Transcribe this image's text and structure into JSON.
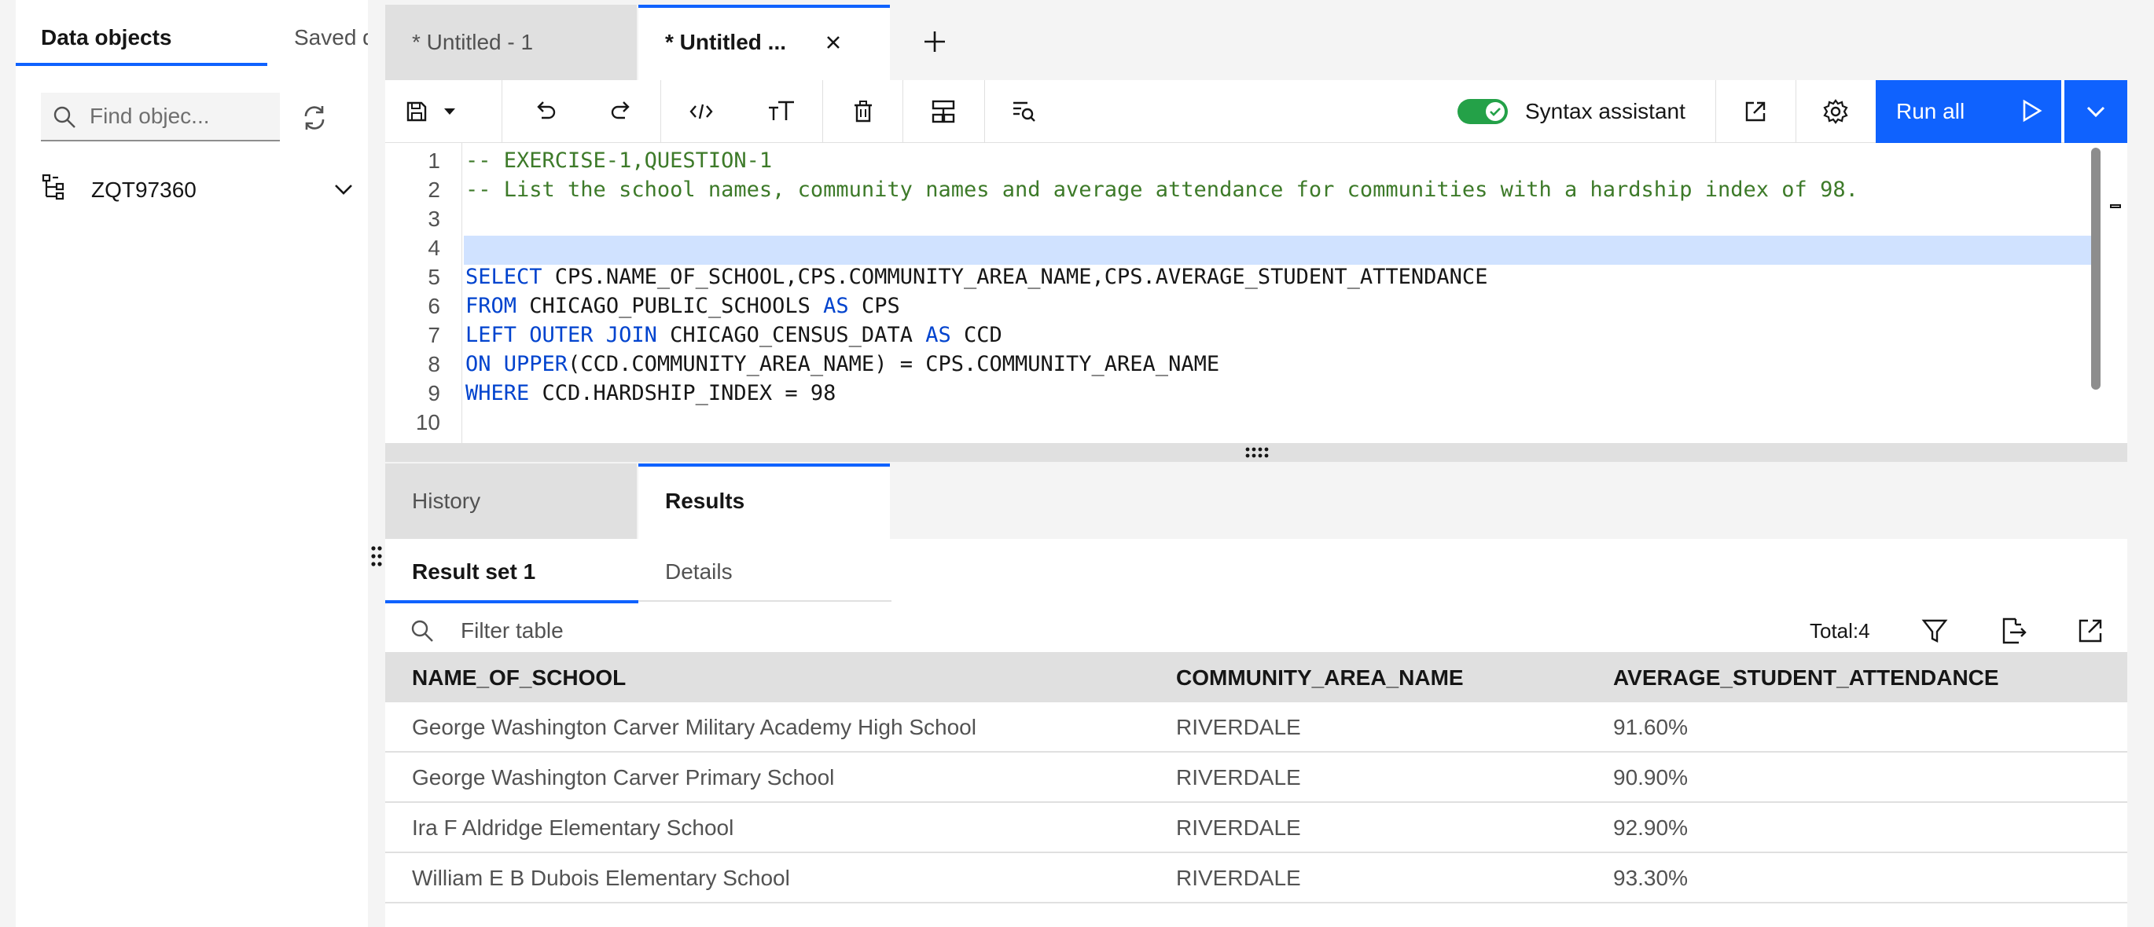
{
  "left_panel": {
    "tabs": [
      "Data objects",
      "Saved q"
    ],
    "search_placeholder": "Find objec...",
    "schema": "ZQT97360"
  },
  "editor_tabs": [
    "* Untitled - 1",
    "* Untitled ..."
  ],
  "toolbar": {
    "syntax_assistant_label": "Syntax assistant",
    "syntax_assistant_on": true,
    "run_all_label": "Run all"
  },
  "editor": {
    "line_numbers": [
      "1",
      "2",
      "3",
      "4",
      "5",
      "6",
      "7",
      "8",
      "9",
      "10"
    ],
    "lines": [
      [
        {
          "t": "-- EXERCISE-1,QUESTION-1",
          "c": "cmt"
        }
      ],
      [
        {
          "t": "-- List the school names, community names and average attendance for communities with a hardship index of 98.",
          "c": "cmt"
        }
      ],
      [],
      [],
      [
        {
          "t": "SELECT",
          "c": "kw"
        },
        {
          "t": " CPS.NAME_OF_SCHOOL,CPS.COMMUNITY_AREA_NAME,CPS.AVERAGE_STUDENT_ATTENDANCE",
          "c": ""
        }
      ],
      [
        {
          "t": "FROM",
          "c": "kw"
        },
        {
          "t": " CHICAGO_PUBLIC_SCHOOLS ",
          "c": ""
        },
        {
          "t": "AS",
          "c": "kw"
        },
        {
          "t": " CPS",
          "c": ""
        }
      ],
      [
        {
          "t": "LEFT OUTER JOIN",
          "c": "kw"
        },
        {
          "t": " CHICAGO_CENSUS_DATA ",
          "c": ""
        },
        {
          "t": "AS",
          "c": "kw"
        },
        {
          "t": " CCD",
          "c": ""
        }
      ],
      [
        {
          "t": "ON",
          "c": "kw"
        },
        {
          "t": " ",
          "c": ""
        },
        {
          "t": "UPPER",
          "c": "kw"
        },
        {
          "t": "(CCD.COMMUNITY_AREA_NAME) = CPS.COMMUNITY_AREA_NAME",
          "c": ""
        }
      ],
      [
        {
          "t": "WHERE",
          "c": "kw"
        },
        {
          "t": " CCD.HARDSHIP_INDEX = 98",
          "c": ""
        }
      ],
      []
    ]
  },
  "result_tabs": [
    "History",
    "Results"
  ],
  "results": {
    "subtabs": [
      "Result set 1",
      "Details"
    ],
    "filter_placeholder": "Filter table",
    "total": "Total:4",
    "columns": [
      "NAME_OF_SCHOOL",
      "COMMUNITY_AREA_NAME",
      "AVERAGE_STUDENT_ATTENDANCE"
    ],
    "rows": [
      [
        "George Washington Carver Military Academy High School",
        "RIVERDALE",
        "91.60%"
      ],
      [
        "George Washington Carver Primary School",
        "RIVERDALE",
        "90.90%"
      ],
      [
        "Ira F Aldridge Elementary School",
        "RIVERDALE",
        "92.90%"
      ],
      [
        "William E B Dubois Elementary School",
        "RIVERDALE",
        "93.30%"
      ]
    ]
  },
  "colors": {
    "accent": "#0f62fe",
    "toggle_on": "#24a148",
    "comment": "#3d7a29",
    "keyword": "#0043ce",
    "active_line": "#d0e2ff"
  }
}
